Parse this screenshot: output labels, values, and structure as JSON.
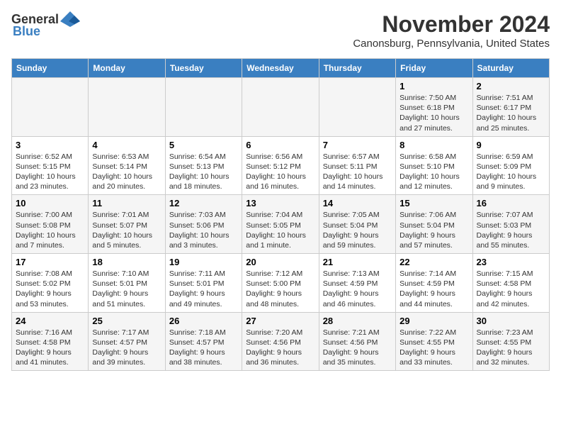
{
  "header": {
    "logo_general": "General",
    "logo_blue": "Blue",
    "title": "November 2024",
    "subtitle": "Canonsburg, Pennsylvania, United States"
  },
  "weekdays": [
    "Sunday",
    "Monday",
    "Tuesday",
    "Wednesday",
    "Thursday",
    "Friday",
    "Saturday"
  ],
  "weeks": [
    [
      {
        "day": "",
        "info": ""
      },
      {
        "day": "",
        "info": ""
      },
      {
        "day": "",
        "info": ""
      },
      {
        "day": "",
        "info": ""
      },
      {
        "day": "",
        "info": ""
      },
      {
        "day": "1",
        "info": "Sunrise: 7:50 AM\nSunset: 6:18 PM\nDaylight: 10 hours and 27 minutes."
      },
      {
        "day": "2",
        "info": "Sunrise: 7:51 AM\nSunset: 6:17 PM\nDaylight: 10 hours and 25 minutes."
      }
    ],
    [
      {
        "day": "3",
        "info": "Sunrise: 6:52 AM\nSunset: 5:15 PM\nDaylight: 10 hours and 23 minutes."
      },
      {
        "day": "4",
        "info": "Sunrise: 6:53 AM\nSunset: 5:14 PM\nDaylight: 10 hours and 20 minutes."
      },
      {
        "day": "5",
        "info": "Sunrise: 6:54 AM\nSunset: 5:13 PM\nDaylight: 10 hours and 18 minutes."
      },
      {
        "day": "6",
        "info": "Sunrise: 6:56 AM\nSunset: 5:12 PM\nDaylight: 10 hours and 16 minutes."
      },
      {
        "day": "7",
        "info": "Sunrise: 6:57 AM\nSunset: 5:11 PM\nDaylight: 10 hours and 14 minutes."
      },
      {
        "day": "8",
        "info": "Sunrise: 6:58 AM\nSunset: 5:10 PM\nDaylight: 10 hours and 12 minutes."
      },
      {
        "day": "9",
        "info": "Sunrise: 6:59 AM\nSunset: 5:09 PM\nDaylight: 10 hours and 9 minutes."
      }
    ],
    [
      {
        "day": "10",
        "info": "Sunrise: 7:00 AM\nSunset: 5:08 PM\nDaylight: 10 hours and 7 minutes."
      },
      {
        "day": "11",
        "info": "Sunrise: 7:01 AM\nSunset: 5:07 PM\nDaylight: 10 hours and 5 minutes."
      },
      {
        "day": "12",
        "info": "Sunrise: 7:03 AM\nSunset: 5:06 PM\nDaylight: 10 hours and 3 minutes."
      },
      {
        "day": "13",
        "info": "Sunrise: 7:04 AM\nSunset: 5:05 PM\nDaylight: 10 hours and 1 minute."
      },
      {
        "day": "14",
        "info": "Sunrise: 7:05 AM\nSunset: 5:04 PM\nDaylight: 9 hours and 59 minutes."
      },
      {
        "day": "15",
        "info": "Sunrise: 7:06 AM\nSunset: 5:04 PM\nDaylight: 9 hours and 57 minutes."
      },
      {
        "day": "16",
        "info": "Sunrise: 7:07 AM\nSunset: 5:03 PM\nDaylight: 9 hours and 55 minutes."
      }
    ],
    [
      {
        "day": "17",
        "info": "Sunrise: 7:08 AM\nSunset: 5:02 PM\nDaylight: 9 hours and 53 minutes."
      },
      {
        "day": "18",
        "info": "Sunrise: 7:10 AM\nSunset: 5:01 PM\nDaylight: 9 hours and 51 minutes."
      },
      {
        "day": "19",
        "info": "Sunrise: 7:11 AM\nSunset: 5:01 PM\nDaylight: 9 hours and 49 minutes."
      },
      {
        "day": "20",
        "info": "Sunrise: 7:12 AM\nSunset: 5:00 PM\nDaylight: 9 hours and 48 minutes."
      },
      {
        "day": "21",
        "info": "Sunrise: 7:13 AM\nSunset: 4:59 PM\nDaylight: 9 hours and 46 minutes."
      },
      {
        "day": "22",
        "info": "Sunrise: 7:14 AM\nSunset: 4:59 PM\nDaylight: 9 hours and 44 minutes."
      },
      {
        "day": "23",
        "info": "Sunrise: 7:15 AM\nSunset: 4:58 PM\nDaylight: 9 hours and 42 minutes."
      }
    ],
    [
      {
        "day": "24",
        "info": "Sunrise: 7:16 AM\nSunset: 4:58 PM\nDaylight: 9 hours and 41 minutes."
      },
      {
        "day": "25",
        "info": "Sunrise: 7:17 AM\nSunset: 4:57 PM\nDaylight: 9 hours and 39 minutes."
      },
      {
        "day": "26",
        "info": "Sunrise: 7:18 AM\nSunset: 4:57 PM\nDaylight: 9 hours and 38 minutes."
      },
      {
        "day": "27",
        "info": "Sunrise: 7:20 AM\nSunset: 4:56 PM\nDaylight: 9 hours and 36 minutes."
      },
      {
        "day": "28",
        "info": "Sunrise: 7:21 AM\nSunset: 4:56 PM\nDaylight: 9 hours and 35 minutes."
      },
      {
        "day": "29",
        "info": "Sunrise: 7:22 AM\nSunset: 4:55 PM\nDaylight: 9 hours and 33 minutes."
      },
      {
        "day": "30",
        "info": "Sunrise: 7:23 AM\nSunset: 4:55 PM\nDaylight: 9 hours and 32 minutes."
      }
    ]
  ]
}
